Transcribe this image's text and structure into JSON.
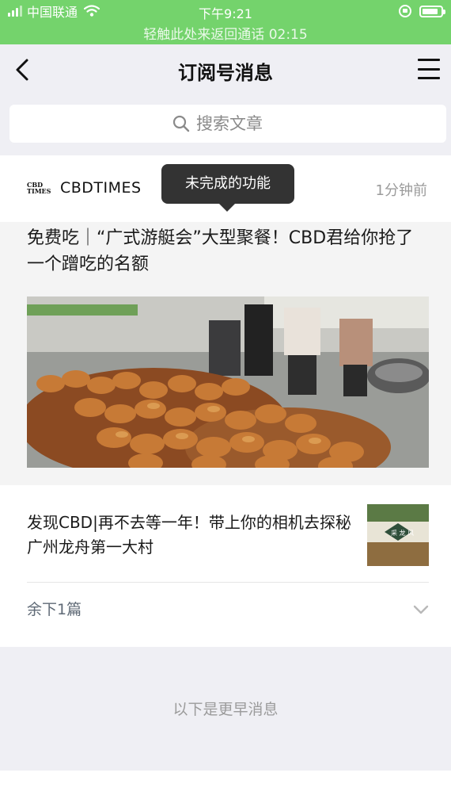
{
  "status_bar": {
    "carrier": "中国联通",
    "time": "下午9:21",
    "call_banner": "轻触此处来返回通话 02:15",
    "battery_level": 0.85
  },
  "nav": {
    "title": "订阅号消息"
  },
  "search": {
    "placeholder": "搜索文章"
  },
  "feed": {
    "account_logo_text": "CBD TIMES",
    "account_name": "CBDTIMES",
    "time_ago": "1分钟前",
    "tooltip": "未完成的功能",
    "main_title": "免费吃｜“广式游艇会”大型聚餐！CBD君给你抢了一个蹭吃的名额",
    "sub_title": "发现CBD|再不去等一年！带上你的相机去探秘广州龙舟第一大村",
    "thumb_text": "采 龙 风",
    "more_label": "余下1篇",
    "earlier_label": "以下是更早消息"
  },
  "colors": {
    "status_green": "#74d36c",
    "background": "#efeff4",
    "tooltip_bg": "#333333"
  }
}
